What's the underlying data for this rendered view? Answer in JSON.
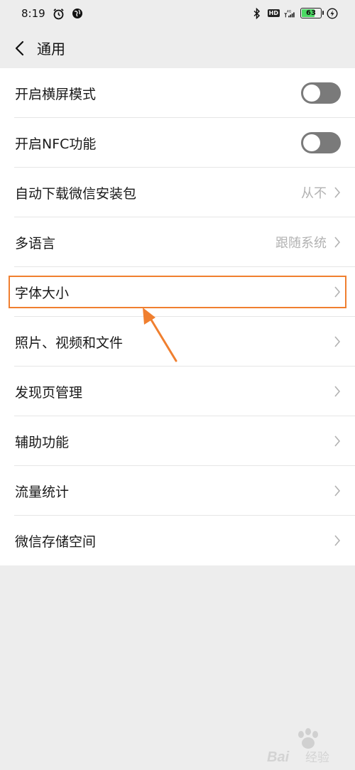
{
  "status_bar": {
    "time": "8:19",
    "hd_label": "HD",
    "network_label": "4G",
    "battery_level": "63"
  },
  "header": {
    "title": "通用"
  },
  "settings": {
    "items": [
      {
        "label": "开启横屏模式",
        "value": "",
        "control": "toggle",
        "toggle_on": false
      },
      {
        "label": "开启NFC功能",
        "value": "",
        "control": "toggle",
        "toggle_on": false
      },
      {
        "label": "自动下载微信安装包",
        "value": "从不",
        "control": "chevron"
      },
      {
        "label": "多语言",
        "value": "跟随系统",
        "control": "chevron"
      },
      {
        "label": "字体大小",
        "value": "",
        "control": "chevron"
      },
      {
        "label": "照片、视频和文件",
        "value": "",
        "control": "chevron"
      },
      {
        "label": "发现页管理",
        "value": "",
        "control": "chevron"
      },
      {
        "label": "辅助功能",
        "value": "",
        "control": "chevron"
      },
      {
        "label": "流量统计",
        "value": "",
        "control": "chevron"
      },
      {
        "label": "微信存储空间",
        "value": "",
        "control": "chevron"
      }
    ]
  },
  "annotation": {
    "highlighted_item": "字体大小",
    "color": "#f07f2f"
  },
  "watermark": {
    "text_latin": "Bai",
    "text_suffix": "经验"
  },
  "colors": {
    "background": "#ededed",
    "toggle_off": "#7a7a7a",
    "secondary_text": "#b2b2b2",
    "annotation": "#f07f2f"
  }
}
